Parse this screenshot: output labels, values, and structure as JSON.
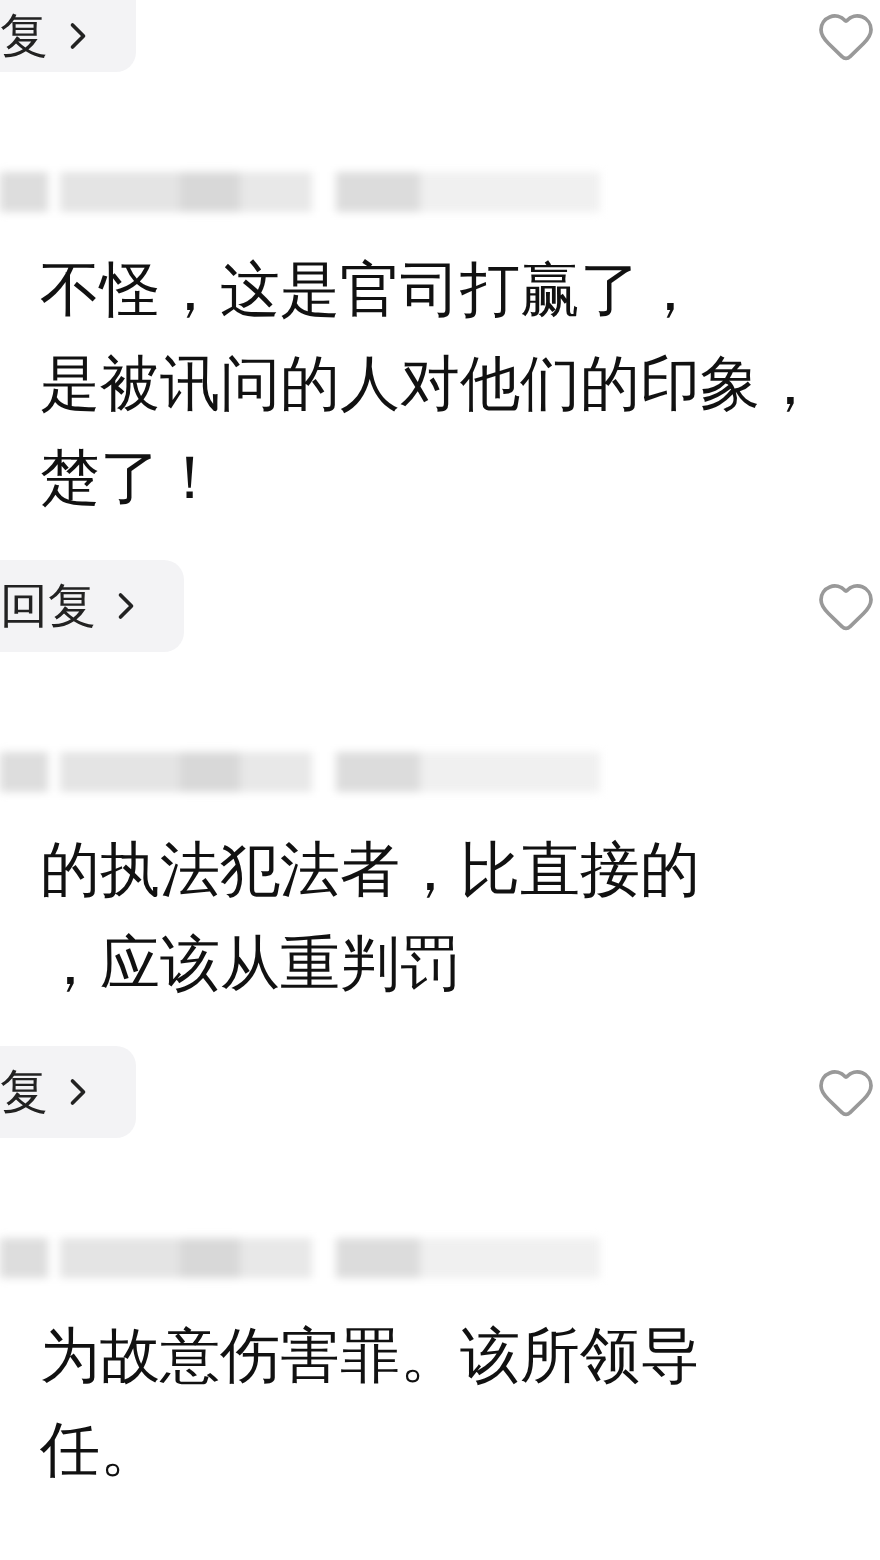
{
  "top_reply": {
    "label": "复",
    "liked": false
  },
  "comments": [
    {
      "lines": [
        "不怪，这是官司打赢了，",
        "是被讯问的人对他们的印象，",
        "楚了！"
      ],
      "reply": "回复",
      "liked": false
    },
    {
      "lines": [
        "的执法犯法者，比直接的",
        "，应该从重判罚"
      ],
      "reply": "复",
      "liked": false
    },
    {
      "lines": [
        "为故意伤害罪。该所领导",
        "任。"
      ]
    }
  ]
}
